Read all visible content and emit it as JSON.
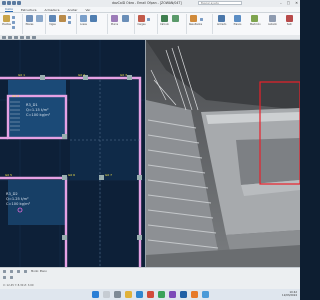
{
  "window": {
    "title": "dazCalD Obra - Email Ofpan - [ZOWAN/04T]",
    "search_placeholder": "Buscar ayuda",
    "minimize": "–",
    "maximize": "□",
    "close": "✕"
  },
  "tabs": [
    {
      "label": "Inicio"
    },
    {
      "label": "Estructura"
    },
    {
      "label": "Armadura"
    },
    {
      "label": "Anotar"
    },
    {
      "label": "Ver"
    }
  ],
  "ribbon": {
    "groups": [
      {
        "label": "Plantas"
      },
      {
        "label": "Pilares"
      },
      {
        "label": "Vigas"
      },
      {
        "label": "Losas"
      },
      {
        "label": "Muros"
      },
      {
        "label": "Cargas"
      },
      {
        "label": "Cálculo"
      },
      {
        "label": "Resultados"
      }
    ],
    "right_buttons": [
      {
        "label": "Armado"
      },
      {
        "label": "Planos"
      },
      {
        "label": "Medición"
      },
      {
        "label": "Listado"
      },
      {
        "label": "Salir"
      }
    ]
  },
  "plan_view": {
    "labels": [
      "G0 1",
      "G0 2",
      "G0 3",
      "G0 4",
      "G0 5",
      "G0 6",
      "G0 7"
    ],
    "slab_a": {
      "name": "R3_D1",
      "line1": "Q=1.15 t/m²",
      "line2": "C=100 kg/m²"
    },
    "slab_b": {
      "name": "R3_D2",
      "line1": "Q=1.25 t/m²",
      "line2": "C=100 kg/m²"
    }
  },
  "view3d": {
    "selection_color": "#e8202a"
  },
  "statusbar": {
    "mode_label": "Modo: Plano",
    "coords": "X: 12.45  Y: 8.30  Z: 3.00"
  },
  "taskbar": {
    "time": "10:42",
    "date": "12/03/2024",
    "lang": "ESP"
  },
  "colors": {
    "plan_background": "#0d2038",
    "wall_pink": "#e6a1e4",
    "slab_fill": "#1b4a77",
    "beam_label": "#f2e14a"
  }
}
